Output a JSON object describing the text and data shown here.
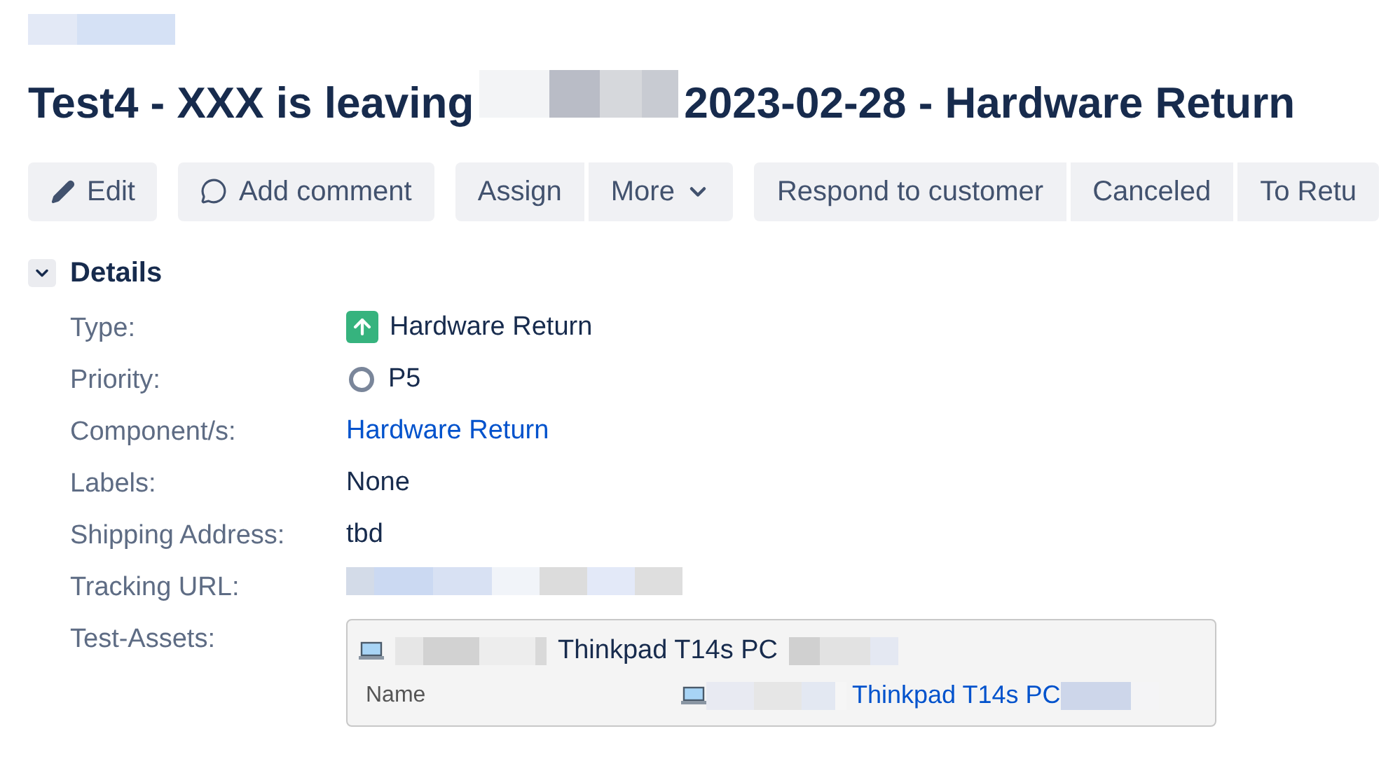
{
  "title": {
    "before": "Test4 - XXX is leaving",
    "after": "2023-02-28 - Hardware Return"
  },
  "toolbar": [
    {
      "group": [
        {
          "label": "Edit",
          "kind": "edit"
        }
      ]
    },
    {
      "group": [
        {
          "label": "Add comment",
          "kind": "comment"
        }
      ]
    },
    {
      "group": [
        {
          "label": "Assign",
          "kind": "plain"
        },
        {
          "label": "More",
          "kind": "dropdown"
        }
      ]
    },
    {
      "group": [
        {
          "label": "Respond to customer",
          "kind": "plain"
        },
        {
          "label": "Canceled",
          "kind": "plain"
        },
        {
          "label": "To Retu",
          "kind": "plain"
        }
      ]
    }
  ],
  "details": {
    "title": "Details",
    "expanded": true,
    "fields": [
      {
        "label": "Type:",
        "kind": "type",
        "value": "Hardware Return"
      },
      {
        "label": "Priority:",
        "kind": "priority",
        "value": "P5"
      },
      {
        "label": "Component/s:",
        "kind": "link",
        "value": "Hardware Return"
      },
      {
        "label": "Labels:",
        "kind": "text",
        "value": "None"
      },
      {
        "label": "Shipping Address:",
        "kind": "text",
        "value": "tbd"
      },
      {
        "label": "Tracking URL:",
        "kind": "redacted"
      },
      {
        "label": "Test-Assets:",
        "kind": "assets",
        "asset": "Thinkpad T14s PC",
        "name_label": "Name",
        "name_value": "Thinkpad T14s PC"
      }
    ]
  }
}
